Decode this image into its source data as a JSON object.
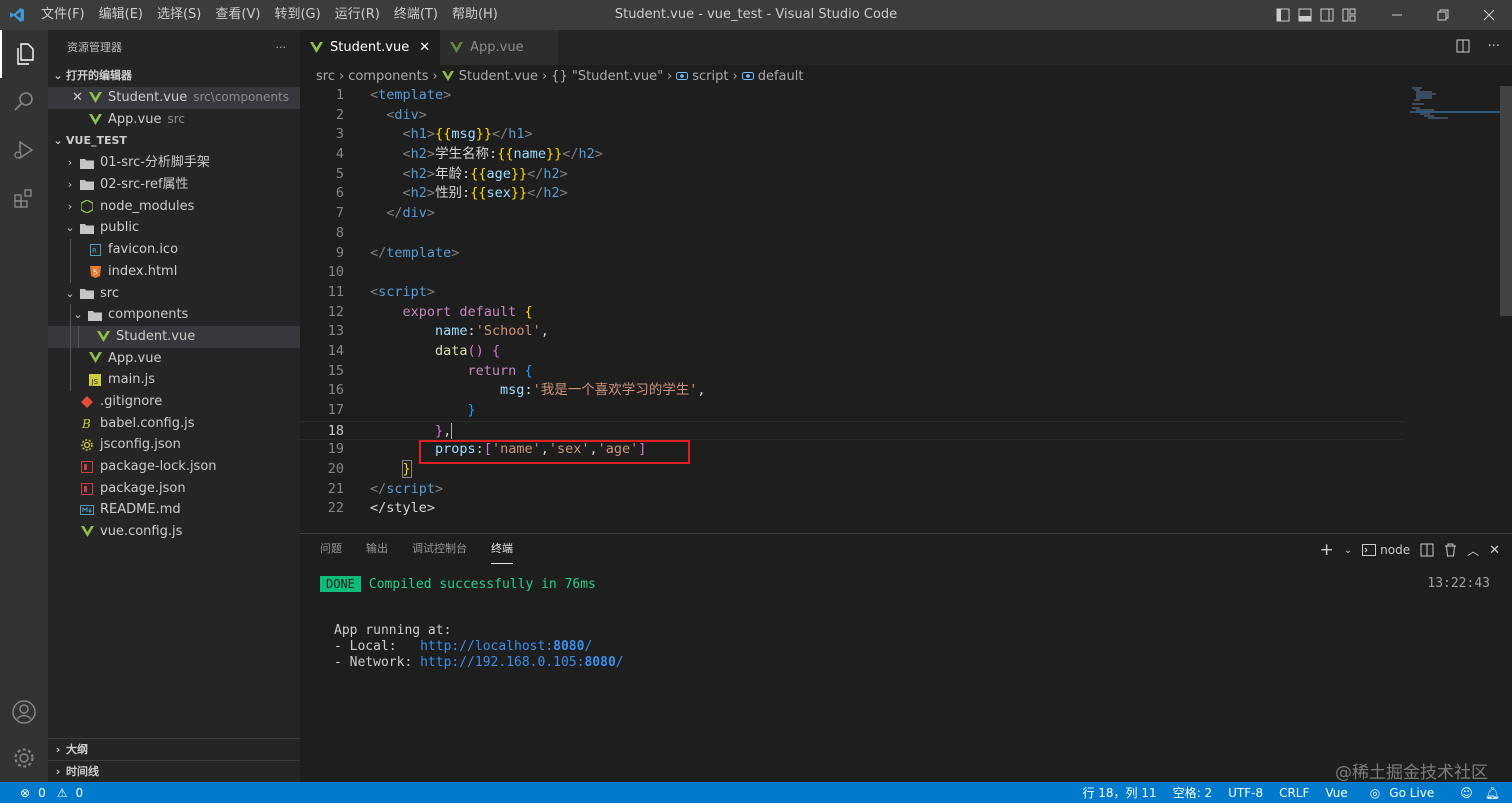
{
  "titlebar": {
    "menu": [
      "文件(F)",
      "编辑(E)",
      "选择(S)",
      "查看(V)",
      "转到(G)",
      "运行(R)",
      "终端(T)",
      "帮助(H)"
    ],
    "window_title": "Student.vue - vue_test - Visual Studio Code"
  },
  "sidebar": {
    "header": "资源管理器",
    "open_editors_label": "打开的编辑器",
    "open_editors": [
      {
        "name": "Student.vue",
        "path": "src\\components"
      },
      {
        "name": "App.vue",
        "path": "src"
      }
    ],
    "project_label": "VUE_TEST",
    "tree": [
      {
        "name": "01-src-分析脚手架"
      },
      {
        "name": "02-src-ref属性"
      },
      {
        "name": "node_modules"
      },
      {
        "name": "public"
      },
      {
        "name": "favicon.ico"
      },
      {
        "name": "index.html"
      },
      {
        "name": "src"
      },
      {
        "name": "components"
      },
      {
        "name": "Student.vue"
      },
      {
        "name": "App.vue"
      },
      {
        "name": "main.js"
      },
      {
        "name": ".gitignore"
      },
      {
        "name": "babel.config.js"
      },
      {
        "name": "jsconfig.json"
      },
      {
        "name": "package-lock.json"
      },
      {
        "name": "package.json"
      },
      {
        "name": "README.md"
      },
      {
        "name": "vue.config.js"
      }
    ],
    "outline_label": "大纲",
    "timeline_label": "时间线"
  },
  "tabs": [
    {
      "label": "Student.vue",
      "active": true
    },
    {
      "label": "App.vue",
      "active": false
    }
  ],
  "breadcrumb": [
    "src",
    "components",
    "Student.vue",
    "{} \"Student.vue\"",
    "script",
    "default"
  ],
  "code": {
    "line_numbers": [
      "1",
      "2",
      "3",
      "4",
      "5",
      "6",
      "7",
      "8",
      "9",
      "10",
      "11",
      "12",
      "13",
      "14",
      "15",
      "16",
      "17",
      "18",
      "19",
      "20",
      "21",
      "22"
    ],
    "current_line": "18",
    "l4_text": "学生名称:",
    "l5_text": "年龄:",
    "l6_text": "性别:",
    "l13_name": "'School'",
    "l16_msg": "'我是一个喜欢学习的学生'",
    "l19_props": [
      "'name'",
      "'sex'",
      "'age'"
    ]
  },
  "panel": {
    "tabs": [
      "问题",
      "输出",
      "调试控制台",
      "终端"
    ],
    "active_tab": "终端",
    "terminal_name": "node",
    "done_badge": "DONE",
    "compiled": "Compiled successfully in 76ms",
    "time": "13:22:43",
    "app_running": "App running at:",
    "local_label": "- Local:   ",
    "local_url_a": "http://localhost:",
    "local_port": "8080",
    "url_tail": "/",
    "network_label": "- Network: ",
    "network_url_a": "http://192.168.0.105:",
    "network_port": "8080"
  },
  "statusbar": {
    "errors": "0",
    "warnings": "0",
    "position": "行 18，列 11",
    "spaces": "空格: 2",
    "encoding": "UTF-8",
    "eol": "CRLF",
    "language": "Vue",
    "golive": "Go Live"
  },
  "watermark": "@稀土掘金技术社区",
  "colors": {
    "accent": "#007acc",
    "highlight": "#e02020"
  }
}
